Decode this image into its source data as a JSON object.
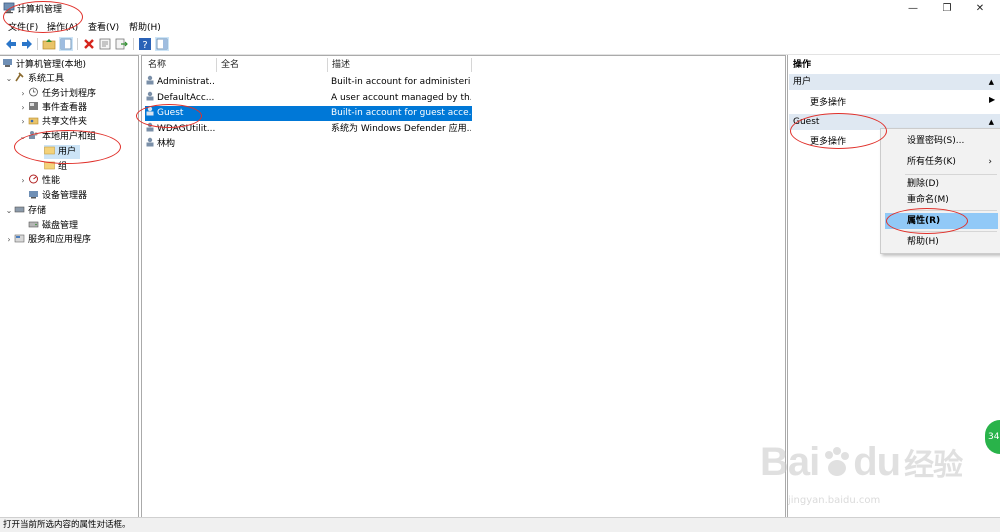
{
  "window": {
    "title": "计算机管理",
    "controls": [
      "—",
      "❐",
      "✕"
    ]
  },
  "menu": [
    "文件(F)",
    "操作(A)",
    "查看(V)",
    "帮助(H)"
  ],
  "tree": [
    {
      "label": "计算机管理(本地)"
    },
    {
      "label": "系统工具"
    },
    {
      "label": "任务计划程序"
    },
    {
      "label": "事件查看器"
    },
    {
      "label": "共享文件夹"
    },
    {
      "label": "本地用户和组"
    },
    {
      "label": "用户"
    },
    {
      "label": "组"
    },
    {
      "label": "性能"
    },
    {
      "label": "设备管理器"
    },
    {
      "label": "存储"
    },
    {
      "label": "磁盘管理"
    },
    {
      "label": "服务和应用程序"
    }
  ],
  "list": {
    "columns": [
      "名称",
      "全名",
      "描述"
    ],
    "rows": [
      {
        "name": "Administrat...",
        "fullname": "",
        "desc": "Built-in account for administeri..."
      },
      {
        "name": "DefaultAcc...",
        "fullname": "",
        "desc": "A user account managed by th..."
      },
      {
        "name": "Guest",
        "fullname": "",
        "desc": "Built-in account for guest acce..."
      },
      {
        "name": "WDAGUtilit...",
        "fullname": "",
        "desc": "系统为 Windows Defender 应用..."
      },
      {
        "name": "林构",
        "fullname": "",
        "desc": ""
      }
    ]
  },
  "actions": {
    "title": "操作",
    "section1": {
      "header": "用户",
      "item": "更多操作"
    },
    "section2": {
      "header": "Guest",
      "item": "更多操作"
    }
  },
  "context_menu": [
    {
      "label": "设置密码(S)..."
    },
    {
      "label": "所有任务(K)"
    },
    {
      "label": "删除(D)"
    },
    {
      "label": "重命名(M)"
    },
    {
      "label": "属性(R)"
    },
    {
      "label": "帮助(H)"
    }
  ],
  "status": "打开当前所选内容的属性对话框。",
  "watermark": {
    "brand": "Bai",
    "brand2": "du",
    "cn": "经验",
    "url": "jingyan.baidu.com"
  },
  "green_button": "34",
  "colors": {
    "selection": "#0078d7",
    "highlight": "#91c9f7",
    "annotation": "#e0302a"
  }
}
